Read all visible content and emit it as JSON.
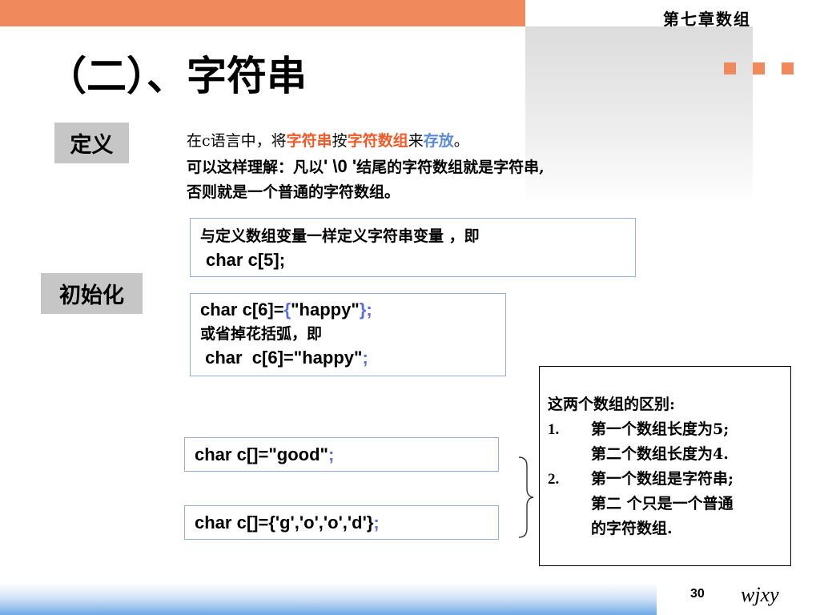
{
  "header": {
    "chapter": "第七章数组",
    "title": "（二）、字符串"
  },
  "labels": {
    "definition": "定义",
    "initialization": "初始化"
  },
  "definition": {
    "l1_a": "在c语言中，将",
    "l1_b": "字符串",
    "l1_c": "按",
    "l1_d": "字符数组",
    "l1_e": "来",
    "l1_f": "存放",
    "l1_g": "。",
    "l2_a": "可以这样理解：凡以",
    "l2_b": "' \\0 '",
    "l2_c": "结尾的字符数组就是字符串,",
    "l3": "否则就是一个普通的字符数组。"
  },
  "box1": {
    "line1": "与定义数组变量一样定义字符串变量 ，即",
    "line2": "char  c[5];"
  },
  "box2": {
    "line1_a": "char  c[6]=",
    "line1_b": "{",
    "line1_c": "\"happy\"",
    "line1_d": "}",
    "line1_e": ";",
    "line2": "或省掉花括弧，即",
    "line3_a": " char  c[6]=\"happy\"",
    "line3_b": ";"
  },
  "box3": {
    "code": "char  c[]=\"good\"",
    "semi": ";"
  },
  "box4": {
    "code": "char  c[]={'g','o','o','d'}",
    "semi": ";"
  },
  "difference": {
    "heading": "这两个数组的区别:",
    "item1_num": "1.",
    "item1_l1": "第一个数组长度为5;",
    "item1_l2": "第二个数组长度为4.",
    "item2_num": "2.",
    "item2_l1": "第一个数组是字符串;",
    "item2_l2": "第二 个只是一个普通",
    "item2_l3": "的字符数组."
  },
  "footer": {
    "page": "30",
    "logo": "wjxy"
  },
  "colors": {
    "accent_orange": "#f08a5d",
    "highlight_red": "#f05a28",
    "highlight_blue": "#5b8ad8",
    "code_brace_blue": "#5b6ee0"
  }
}
